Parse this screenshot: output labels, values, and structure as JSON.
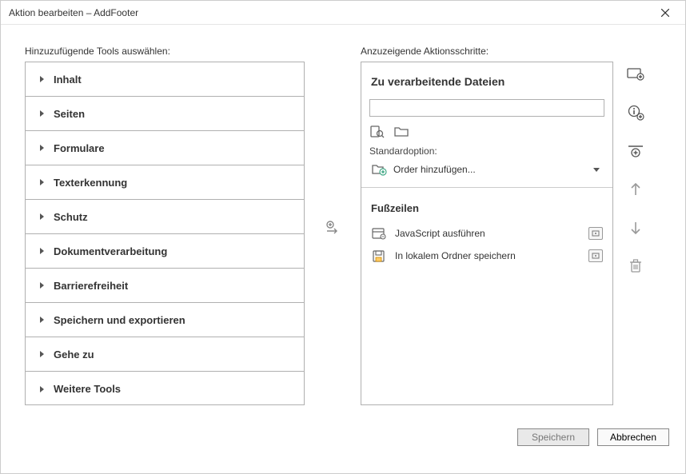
{
  "titlebar": {
    "title": "Aktion bearbeiten – AddFooter"
  },
  "left": {
    "label": "Hinzuzufügende Tools auswählen:",
    "items": [
      {
        "label": "Inhalt"
      },
      {
        "label": "Seiten"
      },
      {
        "label": "Formulare"
      },
      {
        "label": "Texterkennung"
      },
      {
        "label": "Schutz"
      },
      {
        "label": "Dokumentverarbeitung"
      },
      {
        "label": "Barrierefreiheit"
      },
      {
        "label": "Speichern und exportieren"
      },
      {
        "label": "Gehe zu"
      },
      {
        "label": "Weitere Tools"
      }
    ]
  },
  "right": {
    "label": "Anzuzeigende Aktionsschritte:",
    "files_header": "Zu verarbeitende Dateien",
    "input_value": "",
    "standard_option_label": "Standardoption:",
    "dropdown_label": "Order hinzufügen...",
    "subheader": "Fußzeilen",
    "steps": [
      {
        "label": "JavaScript ausführen"
      },
      {
        "label": "In lokalem Ordner speichern"
      }
    ]
  },
  "buttons": {
    "save": "Speichern",
    "cancel": "Abbrechen"
  }
}
